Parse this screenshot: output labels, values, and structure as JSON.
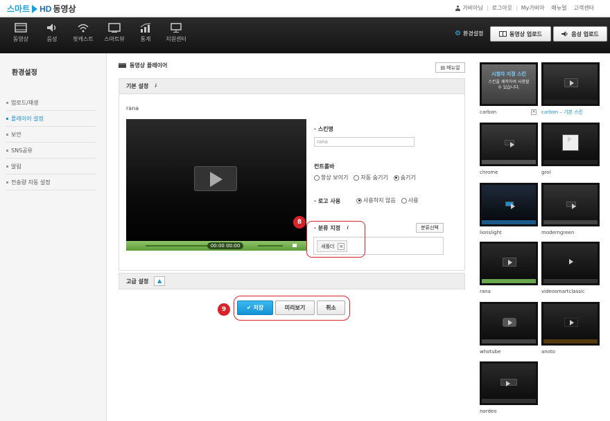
{
  "header": {
    "logo": {
      "smart": "스마트",
      "hd": "HD",
      "rest": "동영상"
    },
    "links": [
      {
        "label": "가비아님"
      },
      {
        "label": "로그아웃"
      },
      {
        "label": "My가비아"
      },
      {
        "label": "매뉴얼"
      },
      {
        "label": "고객센터"
      }
    ]
  },
  "nav": {
    "items": [
      {
        "label": "동영상",
        "icon": "film-icon"
      },
      {
        "label": "음성",
        "icon": "speaker-icon"
      },
      {
        "label": "팟캐스트",
        "icon": "wifi-icon"
      },
      {
        "label": "스마트뷰",
        "icon": "monitor-icon"
      },
      {
        "label": "통계",
        "icon": "chart-icon"
      },
      {
        "label": "지원센터",
        "icon": "support-icon"
      }
    ],
    "settings_label": "환경설정",
    "upload_video": "동영상 업로드",
    "upload_audio": "음성 업로드"
  },
  "sidebar": {
    "title": "환경설정",
    "items": [
      {
        "label": "업로드/재생"
      },
      {
        "label": "플레이어 설정"
      },
      {
        "label": "보안"
      },
      {
        "label": "SNS공유"
      },
      {
        "label": "알림"
      },
      {
        "label": "전송량 자동 설정"
      }
    ],
    "active_index": 1
  },
  "main": {
    "section_title": "동영상 플레이어",
    "manual_label": "매뉴얼",
    "basic": {
      "title": "기본 설정",
      "skin_name": "rana",
      "player_time": "00:00 00:00",
      "skin_label": "· 스킨명",
      "skin_value": "rana",
      "controlbar_label": "컨트롤바",
      "controlbar_options": [
        "항상 보이기",
        "자동 숨기기",
        "숨기기"
      ],
      "controlbar_selected": 2,
      "logo_label": "· 로고 사용",
      "logo_options": [
        "사용하지 않음",
        "사용"
      ],
      "logo_selected": 0,
      "category_label": "· 분류 지정",
      "category_button": "분류선택",
      "category_tag": "새폴더",
      "tag_remove": "×"
    },
    "advanced": {
      "title": "고급 설정"
    },
    "buttons": {
      "save": "저장",
      "preview": "미리보기",
      "cancel": "취소"
    },
    "callouts": {
      "eight": "8",
      "nine": "9"
    }
  },
  "skins": [
    {
      "name": "carbon",
      "caption": "시청자 지정 스킨",
      "caption_sub": "스킨을 제작하여 사용할 수 있습니다."
    },
    {
      "name": "carbon – 기본 스킨",
      "selected": true
    },
    {
      "name": "chrome"
    },
    {
      "name": "grol"
    },
    {
      "name": "lionslight"
    },
    {
      "name": "moderngreen"
    },
    {
      "name": "rana"
    },
    {
      "name": "videosmartclassic"
    },
    {
      "name": "whotube"
    },
    {
      "name": "anoto"
    },
    {
      "name": "nordeo"
    }
  ],
  "colors": {
    "accent": "#1a8fd0",
    "callout": "#d8232a",
    "nav_bg": "#1b1b1b"
  }
}
